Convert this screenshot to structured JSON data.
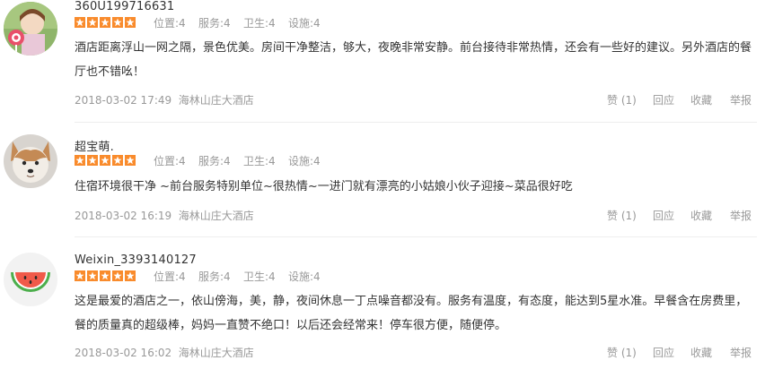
{
  "reviews": [
    {
      "username": "360U199716631",
      "rating_stars": 5,
      "scores": [
        "位置:4",
        "服务:4",
        "卫生:4",
        "设施:4"
      ],
      "content": "酒店距离浮山一网之隔，景色优美。房间干净整洁，够大，夜晚非常安静。前台接待非常热情，还会有一些好的建议。另外酒店的餐厅也不错吆！",
      "time": "2018-03-02 17:49",
      "hotel": "海林山庄大酒店",
      "actions": {
        "like": "赞 (1)",
        "reply": "回应",
        "collect": "收藏",
        "report": "举报"
      },
      "avatar_icon": "girl-with-lollipop-avatar"
    },
    {
      "username": "超宝萌.",
      "rating_stars": 5,
      "scores": [
        "位置:4",
        "服务:4",
        "卫生:4",
        "设施:4"
      ],
      "content": "住宿环境很干净 ~前台服务特别单位~很热情~一进门就有漂亮的小姑娘小伙子迎接~菜品很好吃",
      "time": "2018-03-02 16:19",
      "hotel": "海林山庄大酒店",
      "actions": {
        "like": "赞 (1)",
        "reply": "回应",
        "collect": "收藏",
        "report": "举报"
      },
      "avatar_icon": "corgi-dog-avatar"
    },
    {
      "username": "Weixin_3393140127",
      "rating_stars": 5,
      "scores": [
        "位置:4",
        "服务:4",
        "卫生:4",
        "设施:4"
      ],
      "content": "这是最爱的酒店之一，依山傍海，美，静，夜间休息一丁点噪音都没有。服务有温度，有态度，能达到5星水准。早餐含在房费里，餐的质量真的超级棒，妈妈一直赞不绝口！以后还会经常来！停车很方便，随便停。",
      "time": "2018-03-02 16:02",
      "hotel": "海林山庄大酒店",
      "actions": {
        "like": "赞 (1)",
        "reply": "回应",
        "collect": "收藏",
        "report": "举报"
      },
      "avatar_icon": "watermelon-slice-avatar"
    }
  ],
  "colors": {
    "star_bg": "#f98b2c",
    "muted_text": "#999999",
    "body_text": "#333333"
  }
}
